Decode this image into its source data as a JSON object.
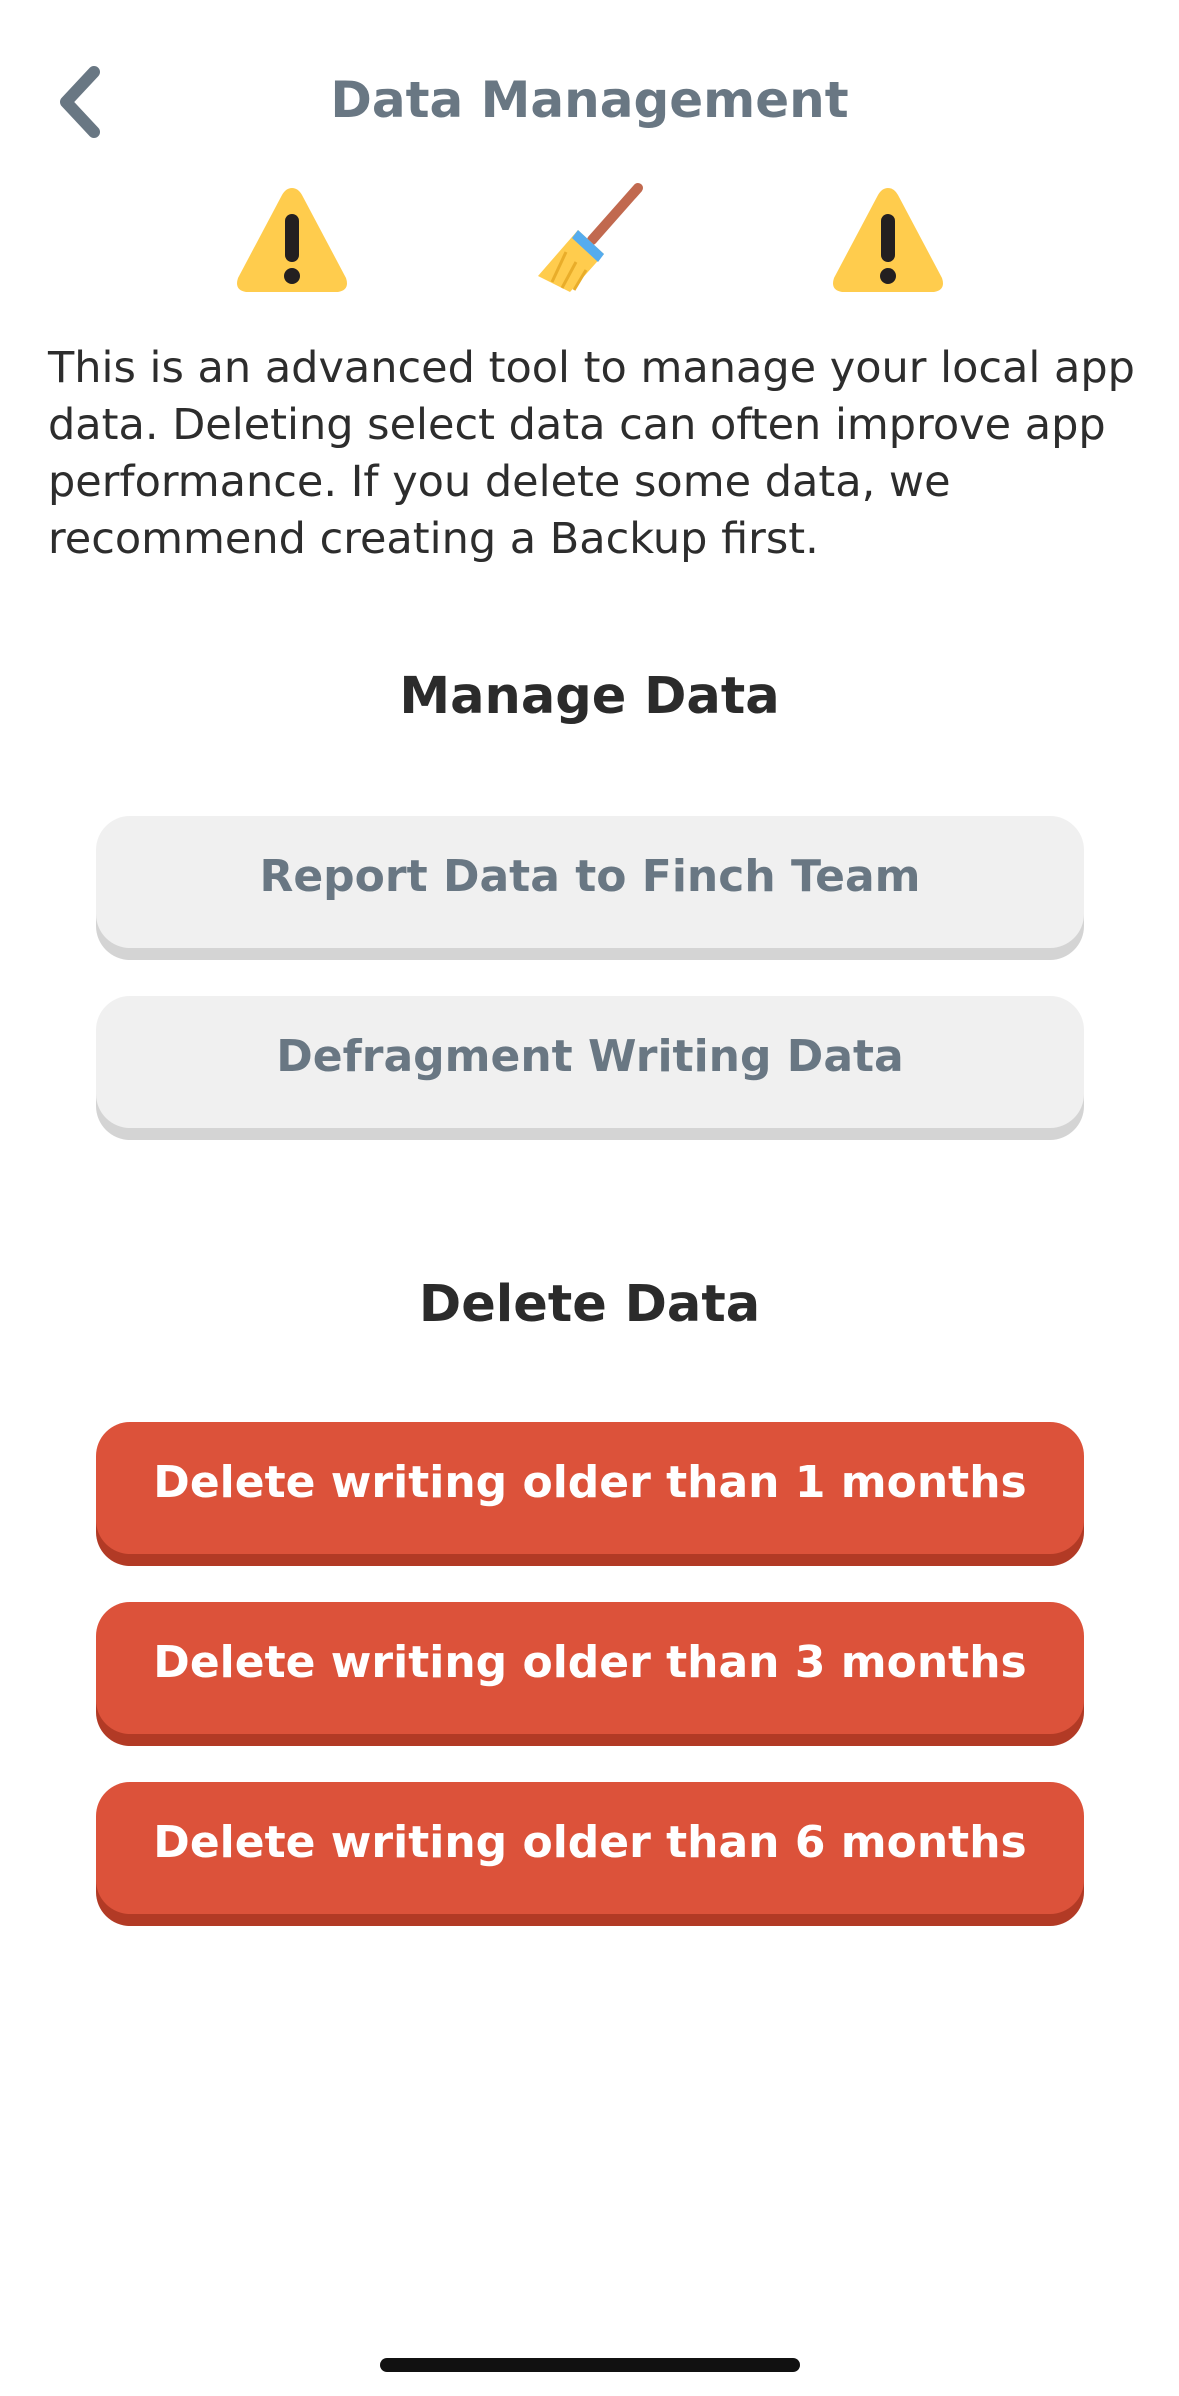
{
  "header": {
    "back_icon": "chevron-left-icon",
    "title": "Data Management"
  },
  "emoji_row": {
    "icons": [
      "warning-icon",
      "broom-icon",
      "warning-icon"
    ]
  },
  "intro_text": "This is an advanced tool to manage your local app data. Deleting select data can often improve app performance. If you delete some data, we recommend creating a Backup first.",
  "manage_section": {
    "title": "Manage Data",
    "buttons": [
      {
        "label": "Report Data to Finch Team"
      },
      {
        "label": "Defragment Writing Data"
      }
    ]
  },
  "delete_section": {
    "title": "Delete Data",
    "buttons": [
      {
        "label": "Delete writing older than 1 months"
      },
      {
        "label": "Delete writing older than 3 months"
      },
      {
        "label": "Delete writing older than 6 months"
      }
    ]
  },
  "colors": {
    "title_grey": "#697783",
    "button_grey": "#f0f0f0",
    "danger_red": "#dc523a",
    "warning_yellow": "#ffcc4d"
  }
}
